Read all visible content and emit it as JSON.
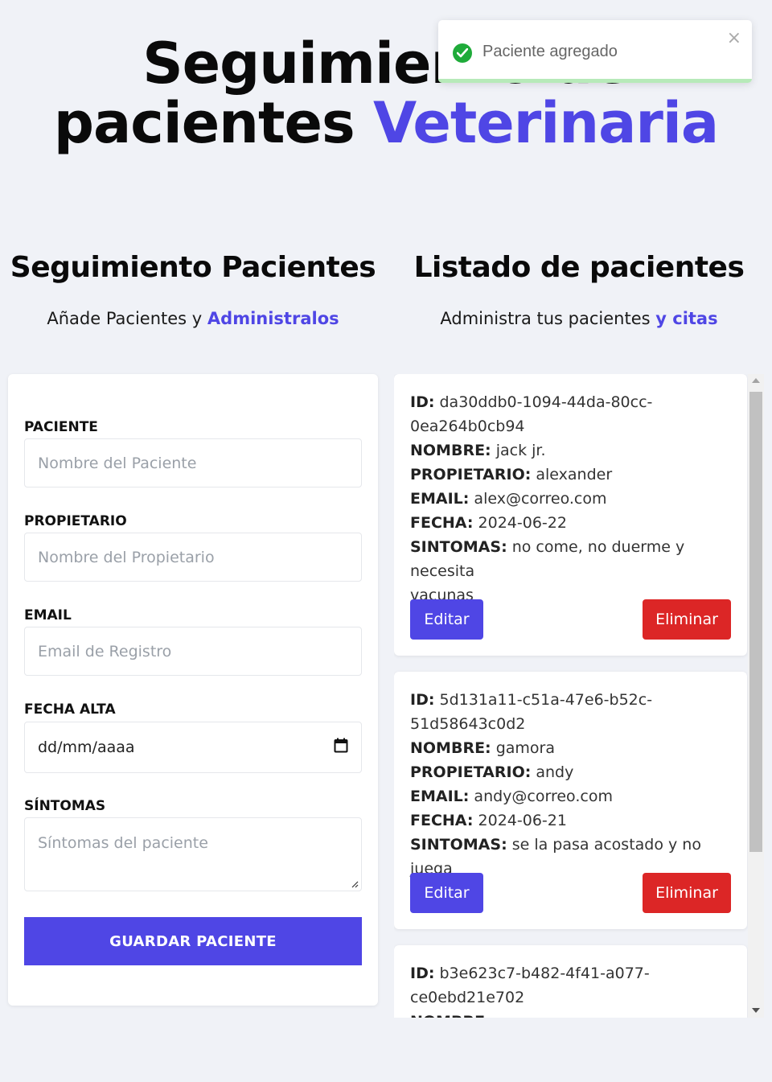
{
  "header": {
    "title_line1": "Seguimiento de",
    "title_line2": "pacientes",
    "title_accent": "Veterinaria"
  },
  "toast": {
    "message": "Paciente agregado",
    "close_glyph": "×",
    "icon": "check-circle-icon",
    "color": "#1fab3a"
  },
  "form_section": {
    "title": "Seguimiento Pacientes",
    "subtitle": "Añade Pacientes y",
    "subtitle_accent": "Administralos",
    "fields": {
      "paciente": {
        "label": "PACIENTE",
        "placeholder": "Nombre del Paciente"
      },
      "propietario": {
        "label": "PROPIETARIO",
        "placeholder": "Nombre del Propietario"
      },
      "email": {
        "label": "EMAIL",
        "placeholder": "Email de Registro"
      },
      "fecha": {
        "label": "FECHA ALTA",
        "value": "dd/mm/aaaa"
      },
      "sintomas": {
        "label": "SÍNTOMAS",
        "placeholder": "Síntomas del paciente"
      }
    },
    "submit_label": "GUARDAR PACIENTE"
  },
  "list_section": {
    "title": "Listado de pacientes",
    "subtitle": "Administra tus pacientes",
    "subtitle_accent": "y citas",
    "labels": {
      "id": "ID:",
      "nombre": "NOMBRE:",
      "propietario": "PROPIETARIO:",
      "email": "EMAIL:",
      "fecha": "FECHA:",
      "sintomas": "SINTOMAS:"
    },
    "edit_label": "Editar",
    "delete_label": "Eliminar",
    "patients": [
      {
        "id_line1": "da30ddb0-1094-44da-80cc-",
        "id_line2": "0ea264b0cb94",
        "nombre": "jack jr.",
        "propietario": "alexander",
        "email": "alex@correo.com",
        "fecha": "2024-06-22",
        "sintomas_line1": "no come, no duerme y necesita",
        "sintomas_line2": "vacunas"
      },
      {
        "id_line1": "5d131a11-c51a-47e6-b52c-",
        "id_line2": "51d58643c0d2",
        "nombre": "gamora",
        "propietario": "andy",
        "email": "andy@correo.com",
        "fecha": "2024-06-21",
        "sintomas_line1": "se la pasa acostado y no juega"
      },
      {
        "id_line1": "b3e623c7-b482-4f41-a077-",
        "id_line2": "ce0ebd21e702"
      }
    ]
  },
  "colors": {
    "accent": "#4f46e5",
    "danger": "#dc2626",
    "background": "#f0f2f7"
  }
}
